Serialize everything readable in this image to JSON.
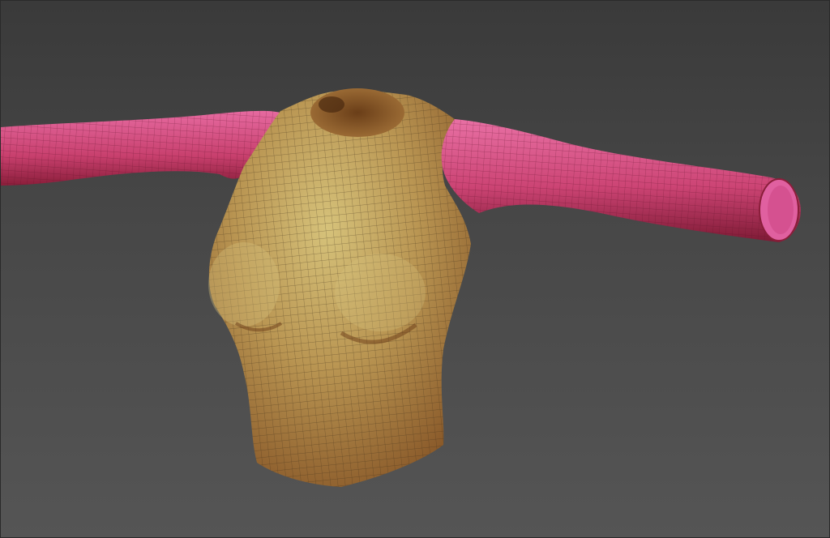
{
  "viewport": {
    "background_top": "#3a3a3a",
    "background_bottom": "#555555"
  },
  "model": {
    "torso_polygroup_color": "#b0884c",
    "torso_highlight_color": "#d6c27a",
    "sleeve_polygroup_color": "#d44a7e",
    "sleeve_highlight_color": "#e66aa0",
    "wireframe_color": "#3b2a18",
    "shows_wireframe": true
  }
}
